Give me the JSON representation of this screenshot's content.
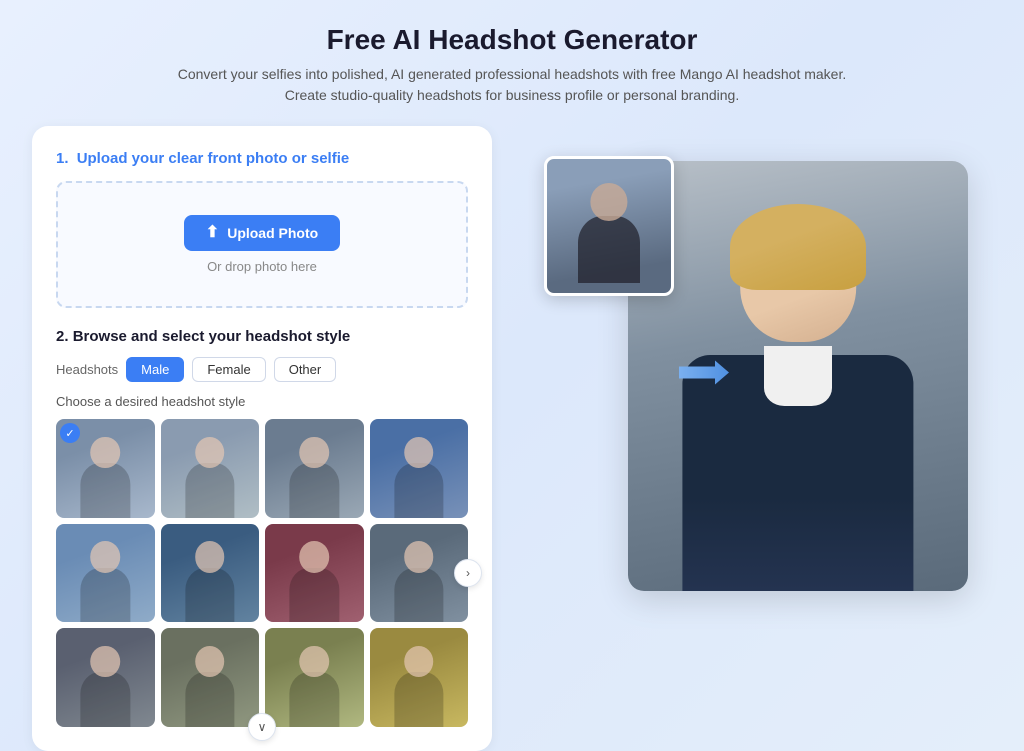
{
  "header": {
    "title": "Free AI Headshot Generator",
    "subtitle": "Convert your selfies into polished, AI generated professional headshots with free Mango AI headshot maker. Create studio-quality headshots for business profile or personal branding."
  },
  "upload_section": {
    "step_number": "1.",
    "step_title": "Upload your clear front photo or selfie",
    "upload_button_label": "Upload Photo",
    "drop_text": "Or drop photo here"
  },
  "browse_section": {
    "step_number": "2.",
    "step_title": "Browse and select your headshot style",
    "filter_label": "Headshots",
    "filters": [
      {
        "label": "Male",
        "active": true
      },
      {
        "label": "Female",
        "active": false
      },
      {
        "label": "Other",
        "active": false
      }
    ],
    "choose_label": "Choose a desired headshot style",
    "style_thumbnails": [
      {
        "id": 1,
        "selected": true,
        "class": "thumb-1"
      },
      {
        "id": 2,
        "selected": false,
        "class": "thumb-2"
      },
      {
        "id": 3,
        "selected": false,
        "class": "thumb-3"
      },
      {
        "id": 4,
        "selected": false,
        "class": "thumb-4"
      },
      {
        "id": 5,
        "selected": false,
        "class": "thumb-5"
      },
      {
        "id": 6,
        "selected": false,
        "class": "thumb-6"
      },
      {
        "id": 7,
        "selected": false,
        "class": "thumb-7"
      },
      {
        "id": 8,
        "selected": false,
        "class": "thumb-8"
      },
      {
        "id": 9,
        "selected": false,
        "class": "thumb-9"
      },
      {
        "id": 10,
        "selected": false,
        "class": "thumb-10"
      },
      {
        "id": 11,
        "selected": false,
        "class": "thumb-11"
      },
      {
        "id": 12,
        "selected": false,
        "class": "thumb-12"
      }
    ]
  },
  "scroll_buttons": {
    "right_icon": "›",
    "down_icon": "∨"
  },
  "icons": {
    "upload": "⟳",
    "arrow_right": "➜",
    "check": "✓"
  }
}
